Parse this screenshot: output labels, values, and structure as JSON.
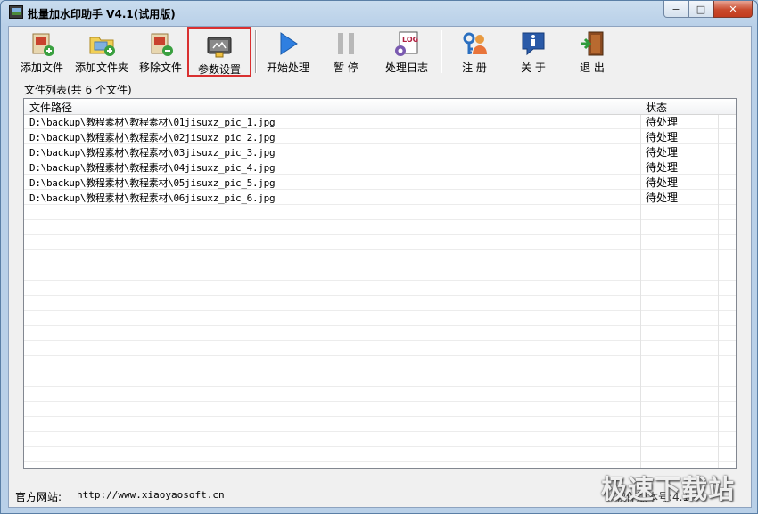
{
  "window": {
    "title": "批量加水印助手 V4.1(试用版)",
    "controls": {
      "minimize": "−",
      "maximize": "□",
      "close": "✕"
    }
  },
  "toolbar": {
    "add_file": "添加文件",
    "add_folder": "添加文件夹",
    "remove_file": "移除文件",
    "settings": "参数设置",
    "start": "开始处理",
    "pause": "暂 停",
    "log": "处理日志",
    "register": "注 册",
    "about": "关 于",
    "exit": "退 出"
  },
  "file_list": {
    "caption": "文件列表(共 6 个文件)",
    "columns": [
      "文件路径",
      "状态"
    ],
    "rows": [
      {
        "path": "D:\\backup\\教程素材\\教程素材\\01jisuxz_pic_1.jpg",
        "status": "待处理"
      },
      {
        "path": "D:\\backup\\教程素材\\教程素材\\02jisuxz_pic_2.jpg",
        "status": "待处理"
      },
      {
        "path": "D:\\backup\\教程素材\\教程素材\\03jisuxz_pic_3.jpg",
        "status": "待处理"
      },
      {
        "path": "D:\\backup\\教程素材\\教程素材\\04jisuxz_pic_4.jpg",
        "status": "待处理"
      },
      {
        "path": "D:\\backup\\教程素材\\教程素材\\05jisuxz_pic_5.jpg",
        "status": "待处理"
      },
      {
        "path": "D:\\backup\\教程素材\\教程素材\\06jisuxz_pic_6.jpg",
        "status": "待处理"
      }
    ]
  },
  "status_bar": {
    "site_label": "官方网站:",
    "site_url": "http://www.xiaoyaosoft.cn",
    "version": "软件版本号:4.1.0"
  },
  "watermark": "极速下载站",
  "colors": {
    "highlight_border": "#d93030",
    "play_blue": "#2f7fe0",
    "exit_green": "#2f9a3a"
  }
}
